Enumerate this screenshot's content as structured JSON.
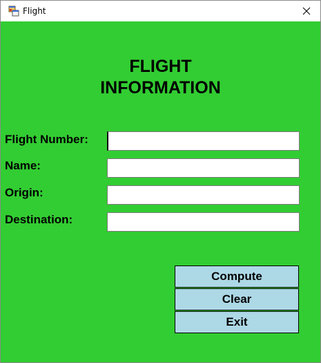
{
  "window": {
    "title": "Flight"
  },
  "form": {
    "heading_line1": "FLIGHT",
    "heading_line2": "INFORMATION",
    "fields": [
      {
        "label": "Flight Number:",
        "value": ""
      },
      {
        "label": "Name:",
        "value": ""
      },
      {
        "label": "Origin:",
        "value": ""
      },
      {
        "label": "Destination:",
        "value": ""
      }
    ]
  },
  "buttons": {
    "compute": "Compute",
    "clear": "Clear",
    "exit": "Exit"
  },
  "colors": {
    "form_background": "#32cd32",
    "button_background": "#add8e6"
  },
  "icons": {
    "app": "winforms-app-icon",
    "close": "close-icon"
  }
}
